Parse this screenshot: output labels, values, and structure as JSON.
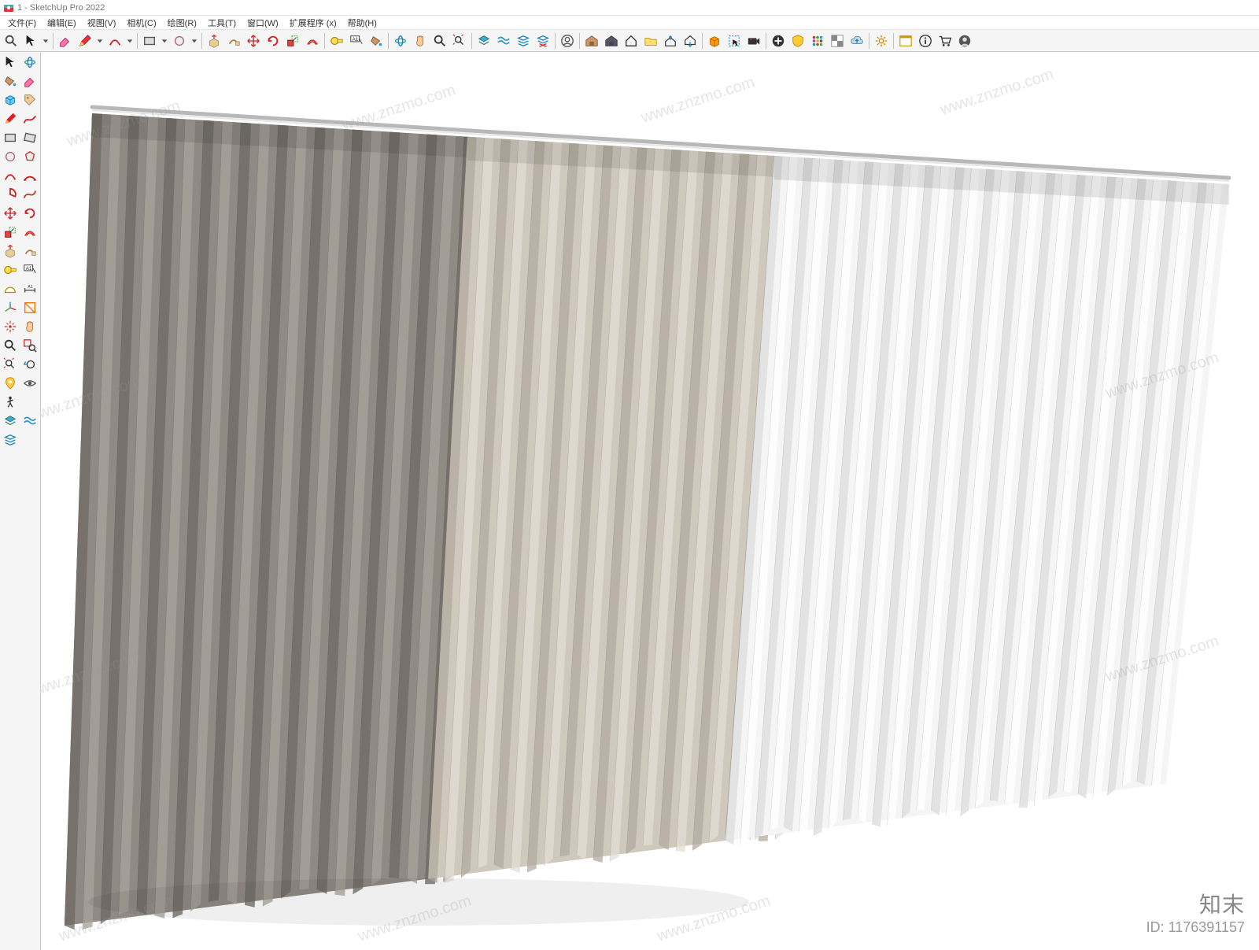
{
  "window": {
    "title": "1 - SketchUp Pro 2022"
  },
  "menu": {
    "items": [
      "文件(F)",
      "编辑(E)",
      "视图(V)",
      "相机(C)",
      "绘图(R)",
      "工具(T)",
      "窗口(W)",
      "扩展程序 (x)",
      "帮助(H)"
    ]
  },
  "toolbar": {
    "groups": [
      {
        "items": [
          "search-icon",
          "select-arrow-icon",
          "dropdown-icon"
        ]
      },
      {
        "items": [
          "eraser-icon",
          "pencil-icon",
          "dropdown-icon",
          "arc-icon",
          "dropdown-icon"
        ]
      },
      {
        "items": [
          "rectangle-icon",
          "dropdown-icon",
          "circle-icon",
          "dropdown-icon"
        ]
      },
      {
        "items": [
          "pushpull-icon",
          "followme-icon",
          "move-icon",
          "rotate-icon",
          "scale-icon",
          "offset-icon"
        ]
      },
      {
        "items": [
          "tape-measure-icon",
          "text-label-icon",
          "paint-bucket-icon"
        ]
      },
      {
        "items": [
          "orbit-icon",
          "hand-pan-icon",
          "zoom-icon",
          "zoom-extents-icon"
        ]
      },
      {
        "items": [
          "layers-blue-icon",
          "layers-waves-icon",
          "layers-stack-icon",
          "layers-crossed-icon"
        ]
      },
      {
        "items": [
          "user-circle-icon"
        ]
      },
      {
        "items": [
          "warehouse-brown-icon",
          "warehouse-dark-icon",
          "house-icon",
          "folder-open-icon",
          "house-up-icon",
          "house-down-icon"
        ]
      },
      {
        "items": [
          "box-orange-icon",
          "select-window-icon",
          "camera-icon"
        ]
      },
      {
        "items": [
          "plus-circle-icon",
          "shield-icon",
          "grid-dots-icon",
          "checker-icon",
          "cloud-up-icon"
        ]
      },
      {
        "items": [
          "gear-icon"
        ]
      },
      {
        "items": [
          "window-app-icon",
          "info-icon",
          "cart-icon",
          "person-icon"
        ]
      }
    ]
  },
  "sidebar": {
    "rows": [
      [
        "select-arrow-icon",
        "orbit-icon"
      ],
      [
        "paint-bucket-icon",
        "eraser-icon"
      ],
      [
        "cube-blue-icon",
        "tag-icon"
      ],
      [
        "pencil-red-icon",
        "freehand-icon"
      ],
      [
        "rectangle-icon",
        "rect-rotated-icon"
      ],
      [
        "circle-icon",
        "polygon-icon"
      ],
      [
        "arc-red-icon",
        "arc2-icon"
      ],
      [
        "pie-icon",
        "spline-icon"
      ],
      [
        "move-icon",
        "rotate-icon"
      ],
      [
        "scale-icon",
        "offset-icon"
      ],
      [
        "pushpull-icon",
        "followme-icon"
      ],
      [
        "tape-measure-icon",
        "text-label-icon"
      ],
      [
        "protractor-icon",
        "dimension-icon"
      ],
      [
        "axes-green-icon",
        "section-icon"
      ],
      [
        "explode-icon",
        "hand-pan-icon"
      ],
      [
        "zoom-icon",
        "zoom-window-icon"
      ],
      [
        "zoom-extents-icon",
        "undo-view-icon"
      ],
      [
        "location-icon",
        "eye-icon"
      ],
      [
        "walk-icon",
        ""
      ],
      [
        "layers-blue-icon",
        "layers-waves-icon"
      ],
      [
        "layers-stack-icon",
        ""
      ]
    ]
  },
  "watermark": {
    "text": "www.znzmo.com",
    "brand": "知末",
    "id_label": "ID: 1176391157"
  }
}
